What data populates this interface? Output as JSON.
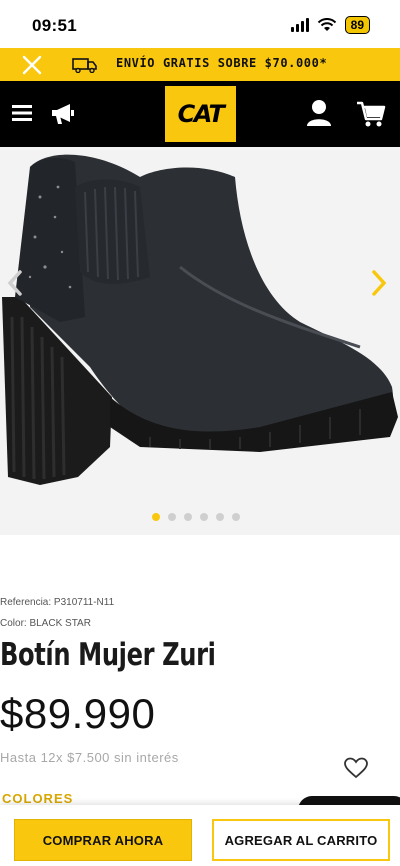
{
  "status": {
    "time": "09:51",
    "battery": "89"
  },
  "promo": {
    "text": "ENVÍO GRATIS SOBRE $70.000*"
  },
  "header": {
    "logo": "CAT"
  },
  "gallery": {
    "image_count": 6,
    "active_index": 0
  },
  "product": {
    "reference": "Referencia: P310711-N11",
    "color": "Color: BLACK STAR",
    "title": "Botín Mujer Zuri",
    "price": "$89.990",
    "installments": "Hasta 12x $7.500 sin interés",
    "colors_heading": "COLORES"
  },
  "actions": {
    "buy_now": "COMPRAR AHORA",
    "add_to_cart": "AGREGAR AL CARRITO"
  },
  "theme": {
    "accent": "#f9c80e",
    "nav_bg": "#000000"
  }
}
